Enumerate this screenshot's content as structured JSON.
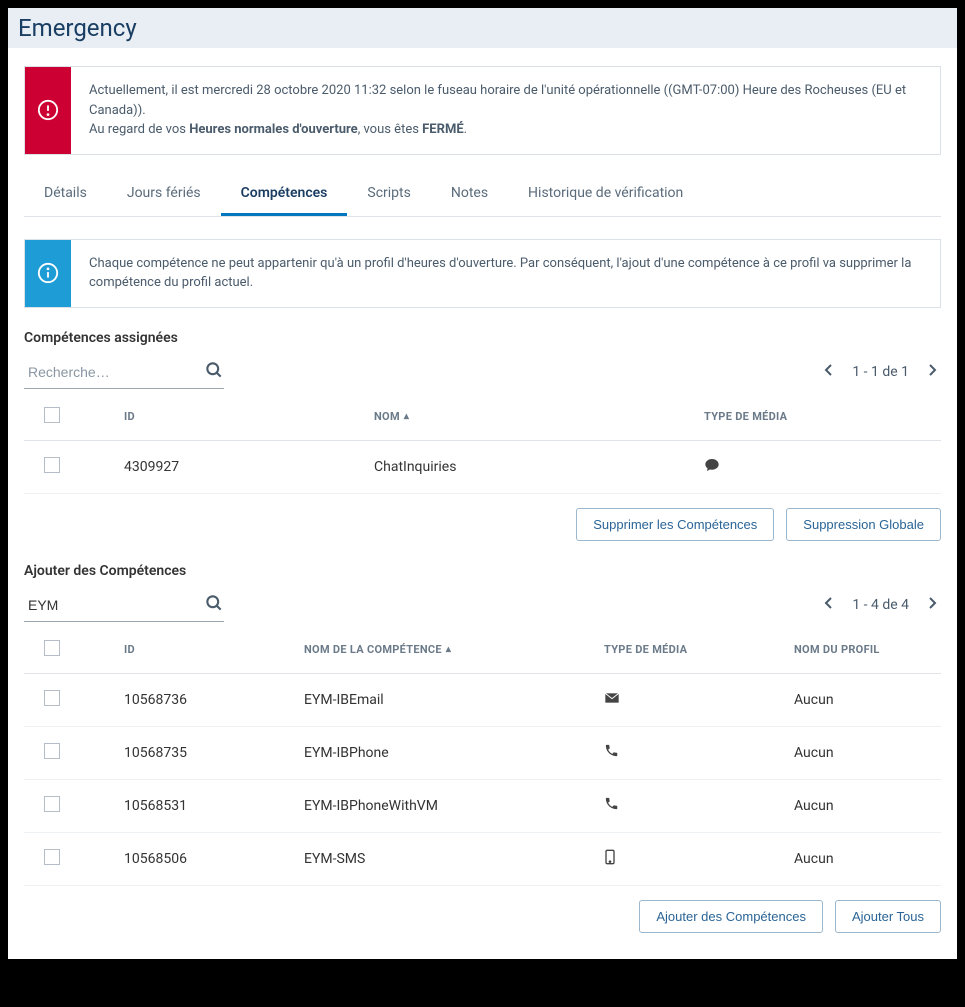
{
  "title": "Emergency",
  "alert": {
    "line1_prefix": "Actuellement, il est mercredi 28 octobre 2020 11:32 selon le fuseau horaire de l'unité opérationnelle ((GMT-07:00) Heure des Rocheuses (EU et Canada)).",
    "line2_prefix": "Au regard de vos ",
    "line2_bold": "Heures normales d'ouverture",
    "line2_mid": ", vous êtes ",
    "line2_status": "FERMÉ",
    "line2_suffix": "."
  },
  "tabs": {
    "details": "Détails",
    "holidays": "Jours fériés",
    "skills": "Compétences",
    "scripts": "Scripts",
    "notes": "Notes",
    "audit": "Historique de vérification"
  },
  "info": "Chaque compétence ne peut appartenir qu'à un profil d'heures d'ouverture. Par conséquent, l'ajout d'une compétence à ce profil va supprimer la compétence du profil actuel.",
  "assigned": {
    "title": "Compétences assignées",
    "search_placeholder": "Recherche…",
    "search_value": "",
    "pager": "1 - 1 de 1",
    "cols": {
      "id": "ID",
      "name": "NOM",
      "media": "TYPE DE MÉDIA"
    },
    "rows": [
      {
        "id": "4309927",
        "name": "ChatInquiries",
        "media": "chat"
      }
    ],
    "btn_remove": "Supprimer les Compétences",
    "btn_remove_all": "Suppression Globale"
  },
  "add": {
    "title": "Ajouter des Compétences",
    "search_value": "EYM",
    "pager": "1 - 4 de 4",
    "cols": {
      "id": "ID",
      "name": "NOM DE LA COMPÉTENCE",
      "media": "TYPE DE MÉDIA",
      "profile": "NOM DU PROFIL"
    },
    "rows": [
      {
        "id": "10568736",
        "name": "EYM-IBEmail",
        "media": "email",
        "profile": "Aucun"
      },
      {
        "id": "10568735",
        "name": "EYM-IBPhone",
        "media": "phone",
        "profile": "Aucun"
      },
      {
        "id": "10568531",
        "name": "EYM-IBPhoneWithVM",
        "media": "phone",
        "profile": "Aucun"
      },
      {
        "id": "10568506",
        "name": "EYM-SMS",
        "media": "mobile",
        "profile": "Aucun"
      }
    ],
    "btn_add": "Ajouter des Compétences",
    "btn_add_all": "Ajouter Tous"
  }
}
